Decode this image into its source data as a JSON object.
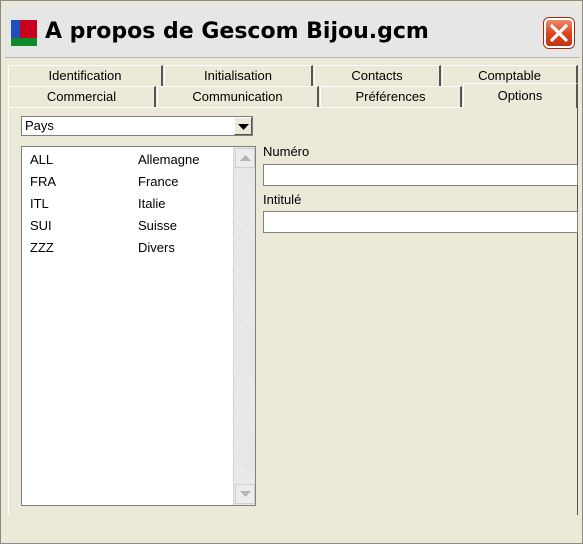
{
  "window": {
    "title": "A propos de Gescom Bijou.gcm",
    "close_icon": "close-icon"
  },
  "tabs": {
    "row1": [
      "Identification",
      "Initialisation",
      "Contacts",
      "Comptable"
    ],
    "row2": [
      "Commercial",
      "Communication",
      "Préférences",
      "Options"
    ],
    "active": "Options"
  },
  "filter": {
    "selected": "Pays"
  },
  "list": {
    "items": [
      {
        "code": "ALL",
        "name": "Allemagne"
      },
      {
        "code": "FRA",
        "name": "France"
      },
      {
        "code": "ITL",
        "name": "Italie"
      },
      {
        "code": "SUI",
        "name": "Suisse"
      },
      {
        "code": "ZZZ",
        "name": "Divers"
      }
    ]
  },
  "form": {
    "numero_label": "Numéro",
    "numero_value": "",
    "intitule_label": "Intitulé",
    "intitule_value": ""
  },
  "colors": {
    "window_bg": "#ece9d8",
    "close_button": "#d9421c"
  }
}
